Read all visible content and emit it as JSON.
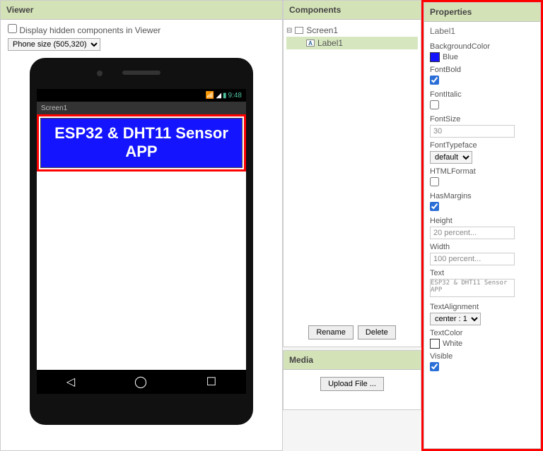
{
  "viewer": {
    "title": "Viewer",
    "hidden_checkbox_label": "Display hidden components in Viewer",
    "picker_value": "Phone size (505,320)",
    "statusbar_time": "9:48",
    "appbar_title": "Screen1",
    "label_text": "ESP32 & DHT11 Sensor APP"
  },
  "components": {
    "title": "Components",
    "root": "Screen1",
    "child": "Label1",
    "rename": "Rename",
    "delete": "Delete"
  },
  "media": {
    "title": "Media",
    "upload": "Upload File ..."
  },
  "properties": {
    "title": "Properties",
    "selected": "Label1",
    "bgcolor_label": "BackgroundColor",
    "bgcolor_name": "Blue",
    "bgcolor_hex": "#1414ff",
    "fontbold_label": "FontBold",
    "fontitalic_label": "FontItalic",
    "fontsize_label": "FontSize",
    "fontsize_value": "30",
    "fonttypeface_label": "FontTypeface",
    "fonttypeface_value": "default",
    "htmlformat_label": "HTMLFormat",
    "hasmargins_label": "HasMargins",
    "height_label": "Height",
    "height_value": "20 percent...",
    "width_label": "Width",
    "width_value": "100 percent...",
    "text_label": "Text",
    "text_value": "ESP32 & DHT11 Sensor APP",
    "textalignment_label": "TextAlignment",
    "textalignment_value": "center : 1",
    "textcolor_label": "TextColor",
    "textcolor_name": "White",
    "textcolor_hex": "#ffffff",
    "visible_label": "Visible"
  }
}
